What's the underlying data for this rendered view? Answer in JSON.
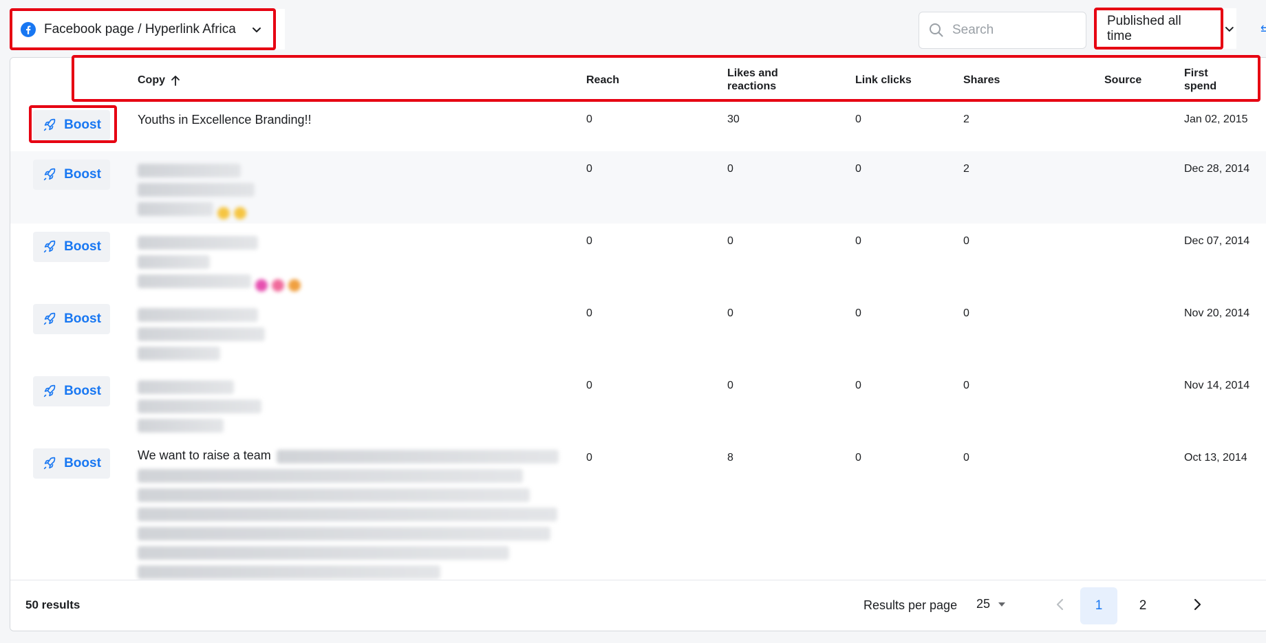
{
  "toolbar": {
    "page_selector_label": "Facebook page / Hyperlink Africa",
    "search_placeholder": "Search",
    "date_filter_label": "Published all time"
  },
  "table": {
    "columns": {
      "copy": "Copy",
      "reach": "Reach",
      "likes_line1": "Likes and",
      "likes_line2": "reactions",
      "link_clicks": "Link clicks",
      "shares": "Shares",
      "source": "Source",
      "first_spend_line1": "First",
      "first_spend_line2": "spend"
    },
    "boost_label": "Boost",
    "rows": [
      {
        "copy": "Youths in Excellence Branding!!",
        "reach": "0",
        "likes": "30",
        "link_clicks": "0",
        "shares": "2",
        "source": "",
        "first_spend": "Jan 02, 2015"
      },
      {
        "copy": "",
        "reach": "0",
        "likes": "0",
        "link_clicks": "0",
        "shares": "2",
        "source": "",
        "first_spend": "Dec 28, 2014"
      },
      {
        "copy": "",
        "reach": "0",
        "likes": "0",
        "link_clicks": "0",
        "shares": "0",
        "source": "",
        "first_spend": "Dec 07, 2014"
      },
      {
        "copy": "",
        "reach": "0",
        "likes": "0",
        "link_clicks": "0",
        "shares": "0",
        "source": "",
        "first_spend": "Nov 20, 2014"
      },
      {
        "copy": "",
        "reach": "0",
        "likes": "0",
        "link_clicks": "0",
        "shares": "0",
        "source": "",
        "first_spend": "Nov 14, 2014"
      },
      {
        "copy": "We want to raise a team",
        "reach": "0",
        "likes": "8",
        "link_clicks": "0",
        "shares": "0",
        "source": "",
        "first_spend": "Oct 13, 2014"
      }
    ]
  },
  "footer": {
    "results_count": "50 results",
    "results_per_page_label": "Results per page",
    "results_per_page_value": "25",
    "pages": [
      "1",
      "2"
    ],
    "current_page": "1"
  },
  "colors": {
    "accent": "#1877f2",
    "highlight_box": "#e60012",
    "active_page_bg": "#e7f0fd"
  },
  "icons": [
    "facebook-icon",
    "chevron-down-icon",
    "search-icon",
    "sort-arrow-up-icon",
    "rocket-icon",
    "chevron-left-icon",
    "chevron-right-icon",
    "caret-down-icon"
  ]
}
